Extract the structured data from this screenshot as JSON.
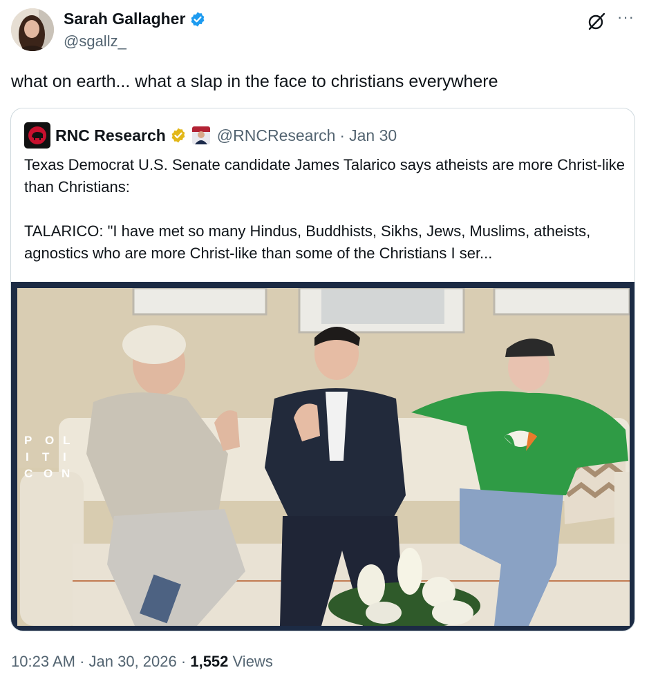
{
  "post": {
    "author_name": "Sarah Gallagher",
    "author_handle": "@sgallz_",
    "text": "what on earth... what a slap in the face to christians everywhere",
    "more_label": "···"
  },
  "quote": {
    "author_name": "RNC Research",
    "author_handle": "@RNCResearch",
    "separator": "·",
    "date": "Jan 30",
    "text": "Texas Democrat U.S. Senate candidate James Talarico says atheists are more Christ-like than Christians:\n\nTALARICO: \"I have met so many Hindus, Buddhists, Sikhs, Jews, Muslims, atheists, agnostics who are more Christ-like than some of the Christians I ser...",
    "media_watermark": [
      "P",
      "O",
      "L",
      "I",
      "T",
      "I",
      "C",
      "O",
      "N"
    ]
  },
  "footer": {
    "time": "10:23 AM",
    "sep1": "·",
    "date": "Jan 30, 2026",
    "sep2": "·",
    "views_count": "1,552",
    "views_label": "Views"
  },
  "colors": {
    "verified_blue": "#1d9bf0",
    "verified_gold": "#e2b719",
    "rnc_red": "#c8102e",
    "media_border": "#1c2b44"
  },
  "icons": {
    "verified": "verified-badge-icon",
    "grok": "grok-icon",
    "more": "more-icon",
    "rnc": "rnc-logo-icon",
    "affiliation": "affiliation-icon"
  }
}
